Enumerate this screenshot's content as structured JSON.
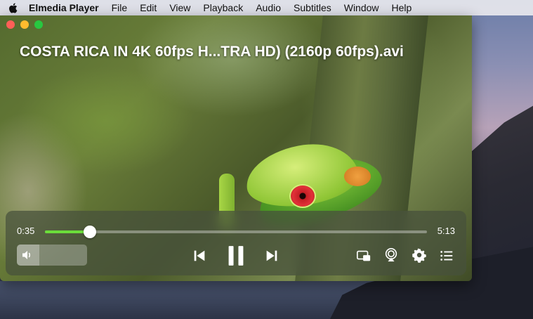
{
  "menubar": {
    "app_name": "Elmedia Player",
    "items": [
      "File",
      "Edit",
      "View",
      "Playback",
      "Audio",
      "Subtitles",
      "Window",
      "Help"
    ]
  },
  "window": {
    "title": "COSTA RICA IN 4K 60fps H...TRA HD) (2160p 60fps).avi"
  },
  "player": {
    "current_time": "0:35",
    "total_time": "5:13",
    "progress_fraction": 0.118,
    "volume_fraction": 0.32,
    "accent_color": "#6bdd3a",
    "icons": {
      "volume": "speaker-icon",
      "previous": "skip-back-icon",
      "play_pause": "pause-icon",
      "next": "skip-forward-icon",
      "pip": "picture-in-picture-icon",
      "airplay": "airplay-icon",
      "settings": "gear-icon",
      "playlist": "playlist-icon"
    }
  }
}
